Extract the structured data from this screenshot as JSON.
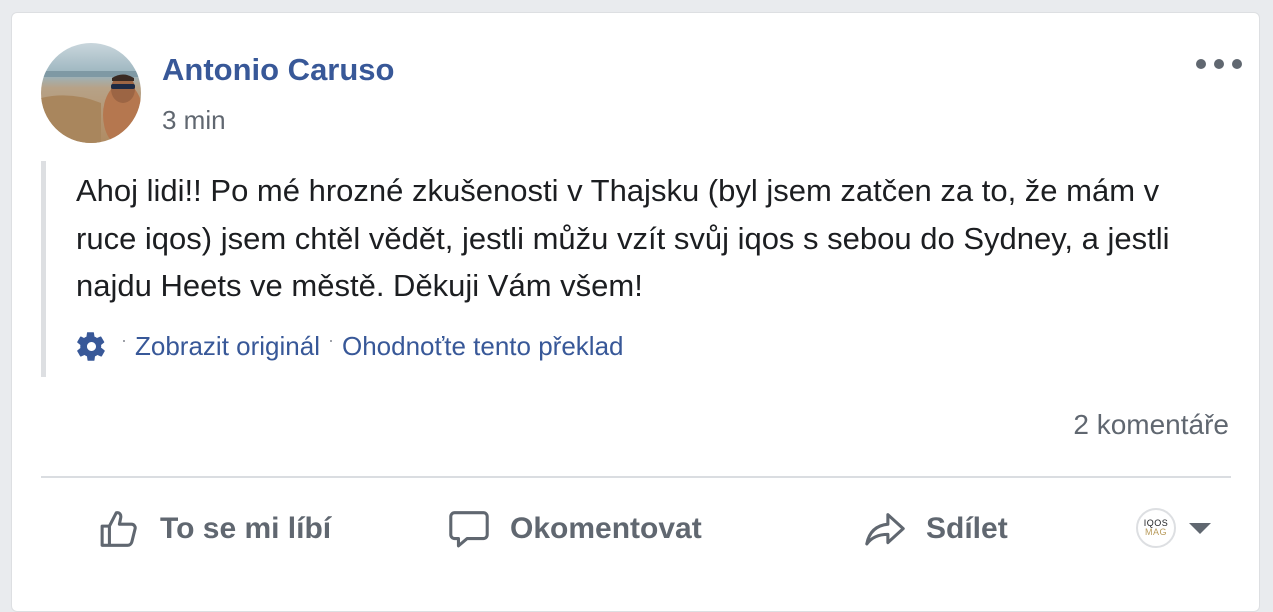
{
  "post": {
    "author": "Antonio Caruso",
    "timestamp": "3 min",
    "text": "Ahoj lidi!! Po mé hrozné zkušenosti v Thajsku (byl jsem zatčen za to, že mám v ruce iqos) jsem chtěl vědět, jestli můžu vzít svůj iqos s sebou do Sydney, a jestli najdu Heets ve městě. Děkuji Vám všem!"
  },
  "translation": {
    "separator": "·",
    "show_original": "Zobrazit originál",
    "rate_translation": "Ohodnoťte tento překlad"
  },
  "stats": {
    "comments": "2 komentáře"
  },
  "actions": {
    "like": "To se mi líbí",
    "comment": "Okomentovat",
    "share": "Sdílet"
  },
  "page_avatar": {
    "line1": "IQOS",
    "line2": "MAG"
  },
  "icons": {
    "more": "more-dots-icon",
    "gear": "gear-icon",
    "like": "thumbs-up-icon",
    "comment": "speech-bubble-icon",
    "share": "share-arrow-icon",
    "caret": "caret-down-icon"
  },
  "colors": {
    "link": "#385898",
    "secondary_text": "#606770",
    "primary_text": "#1c1e21",
    "background": "#e9ebee"
  }
}
